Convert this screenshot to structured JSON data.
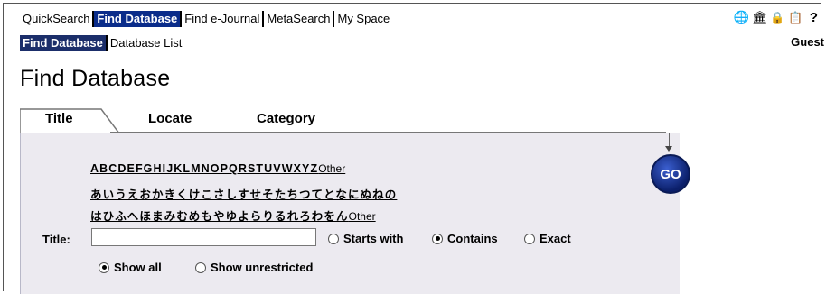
{
  "top_nav": {
    "items": [
      {
        "label": "QuickSearch"
      },
      {
        "label": "Find Database"
      },
      {
        "label": "Find e-Journal"
      },
      {
        "label": "MetaSearch"
      },
      {
        "label": "My Space"
      }
    ]
  },
  "sub_nav": {
    "items": [
      {
        "label": "Find Database"
      },
      {
        "label": "Database List"
      }
    ]
  },
  "user": {
    "label": "Guest"
  },
  "header_icons": [
    "globe-icon",
    "library-icon",
    "lock-icon",
    "clipboard-icon",
    "help-icon"
  ],
  "header_icon_glyphs": [
    "🌐",
    "🏛",
    "🔒",
    "📋",
    "?"
  ],
  "page_title": "Find Database",
  "tabs": [
    {
      "label": "Title"
    },
    {
      "label": "Locate"
    },
    {
      "label": "Category"
    }
  ],
  "char_index": {
    "latin": "ABCDEFGHIJKLMNOPQRSTUVWXYZ",
    "latin_other": "Other",
    "kana_row1": "あいうえおかきくけこさしすせそたちつてとなにぬねの",
    "kana_row2": "はひふへほまみむめもやゆよらりるれろわをん",
    "kana_other": "Other"
  },
  "go_button": {
    "label": "GO"
  },
  "search": {
    "title_label": "Title:",
    "title_value": ""
  },
  "match_options": [
    {
      "label": "Starts with",
      "selected": false
    },
    {
      "label": "Contains",
      "selected": true
    },
    {
      "label": "Exact",
      "selected": false
    }
  ],
  "scope_options": [
    {
      "label": "Show all",
      "selected": true
    },
    {
      "label": "Show unrestricted",
      "selected": false
    }
  ],
  "colors": {
    "nav_active_bg": "#0a2c8a",
    "panel_bg": "#eceaf0",
    "go_button": "#0b1f6a"
  }
}
